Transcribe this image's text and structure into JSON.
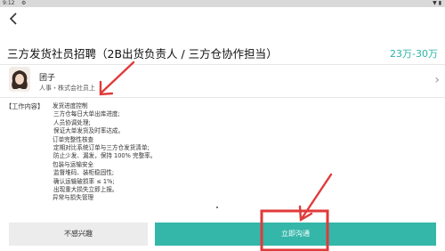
{
  "status_bar": {
    "time": "9:12",
    "icons": [
      "settings-icon",
      "wifi-icon",
      "battery-icon"
    ]
  },
  "nav": {
    "back_icon": "chevron-left-icon"
  },
  "job": {
    "title": "三方发货社员招聘（2B出货负责人 / 三方仓协作担当）",
    "salary": "23万-30万"
  },
  "recruiter": {
    "name": "团子",
    "position": "人事・株式会社员上"
  },
  "description": {
    "label": "【工作内容】",
    "items": [
      "发货进度控制",
      "三方仓每日大单出库进度;",
      "人员协调处理;",
      "保证大单发货及时率达成。",
      "订单完整性核查",
      "定期对比系统订单与三方仓发货清单;",
      "防止少发、漏发，保持 100% 完整率。",
      "包装与运输安全",
      "监督堆码、装柜稳固性;",
      "确认运输破损率 ≤ 1%;",
      "出现重大损失立即上报。",
      "异常与损失管理"
    ]
  },
  "actions": {
    "skip_label": "不感兴趣",
    "chat_label": "立即沟通"
  },
  "colors": {
    "accent": "#34b6a9",
    "salary": "#2ab3a6",
    "annotation": "#e03a3a"
  }
}
